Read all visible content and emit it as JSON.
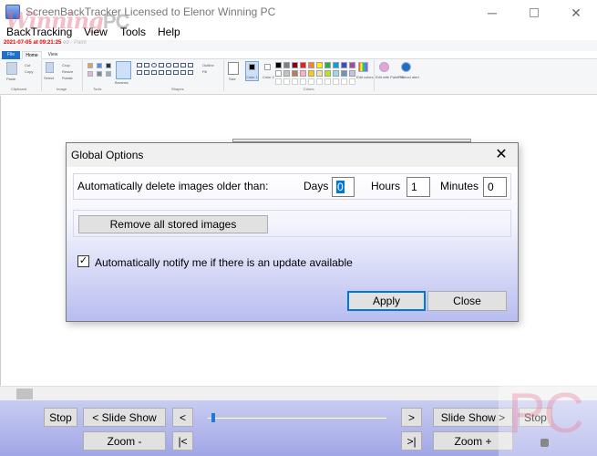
{
  "window": {
    "title": "ScreenBackTracker Licensed to Elenor Winning PC",
    "watermark": "Winning",
    "watermark_suffix": "PC",
    "icons": {
      "app": "app-icon",
      "minimize": "minimize-icon",
      "maximize": "maximize-icon",
      "close": "close-icon"
    },
    "controls": {
      "minimize": "─",
      "close": "✕"
    }
  },
  "menu": {
    "items": [
      "BackTracking",
      "View",
      "Tools",
      "Help"
    ]
  },
  "paint_capture": {
    "timestamp": "2021-07-05 at 09:21:25",
    "title_fragment": "ed - Paint",
    "tabs": [
      "File",
      "Home",
      "View"
    ],
    "groups": [
      "Clipboard",
      "Image",
      "Tools",
      "Shapes",
      "Colors"
    ],
    "tools": {
      "paste": "Paste",
      "cut": "Cut",
      "copy": "Copy",
      "crop": "Crop",
      "resize": "Resize",
      "rotate": "Rotate",
      "select": "Select",
      "brushes": "Brushes",
      "outline": "Outline",
      "fill": "Fill",
      "size": "Size",
      "color1": "Color 1",
      "color2": "Color 2",
      "edit_colors": "Edit colors",
      "edit_paint3d": "Edit with Paint 3D",
      "product_alert": "Product alert"
    },
    "swatch_colors": [
      "#000000",
      "#7f7f7f",
      "#880015",
      "#ed1c24",
      "#ff7f27",
      "#fff200",
      "#22b14c",
      "#00a2e8",
      "#3f48cc",
      "#a349a4",
      "#ffffff",
      "#c3c3c3",
      "#b97a57",
      "#ffaec9",
      "#ffc90e",
      "#efe4b0",
      "#b5e61d",
      "#99d9ea",
      "#7092be",
      "#c8bfe7"
    ]
  },
  "dialog": {
    "title": "Global Options",
    "close_glyph": "✕",
    "auto_delete_label": "Automatically delete images older than:",
    "days_label": "Days",
    "days_value": "0",
    "hours_label": "Hours",
    "hours_value": "1",
    "minutes_label": "Minutes",
    "minutes_value": "0",
    "remove_button": "Remove all stored images",
    "notify_label": "Automatically notify me if there is an update available",
    "notify_checked": true,
    "check_glyph": "✓",
    "apply_button": "Apply",
    "close_button": "Close"
  },
  "nav": {
    "stop_left": "Stop",
    "slideshow_back": "< Slide Show",
    "prev": "<",
    "next": ">",
    "slideshow_forward": "Slide Show >",
    "stop_right": "Stop",
    "zoom_out": "Zoom -",
    "first": "|<",
    "last": ">|",
    "zoom_in": "Zoom +",
    "slider_position": 0.02
  },
  "badge": {
    "text": "PC"
  }
}
